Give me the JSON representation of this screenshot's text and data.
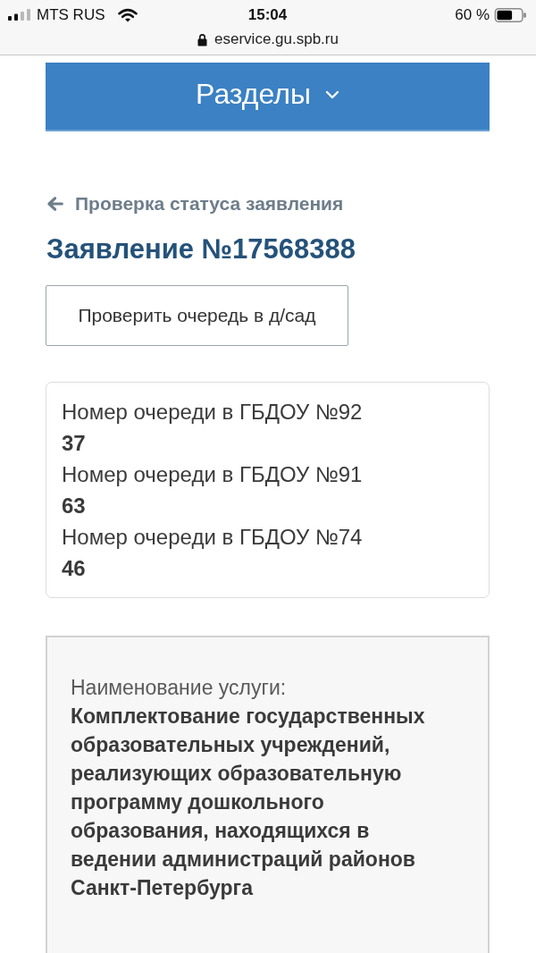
{
  "status_bar": {
    "carrier": "MTS RUS",
    "time": "15:04",
    "battery": "60 %"
  },
  "address_bar": {
    "url": "eservice.gu.spb.ru"
  },
  "sections_menu": {
    "label": "Разделы",
    "expanded": false
  },
  "back_link": {
    "label": "Проверка статуса заявления"
  },
  "title": "Заявление №17568388",
  "check_queue_button": {
    "label": "Проверить очередь в д/сад"
  },
  "queue_positions": [
    {
      "label": "Номер очереди в ГБДОУ №92",
      "value": "37"
    },
    {
      "label": "Номер очереди в ГБДОУ №91",
      "value": "63"
    },
    {
      "label": "Номер очереди в ГБДОУ №74",
      "value": "46"
    }
  ],
  "service": {
    "label": "Наименование услуги:",
    "value": "Комплектование государственных образовательных учреждений, реализующих образовательную программу дошкольного образования, находящихся в ведении администраций районов Санкт-Петербурга"
  }
}
